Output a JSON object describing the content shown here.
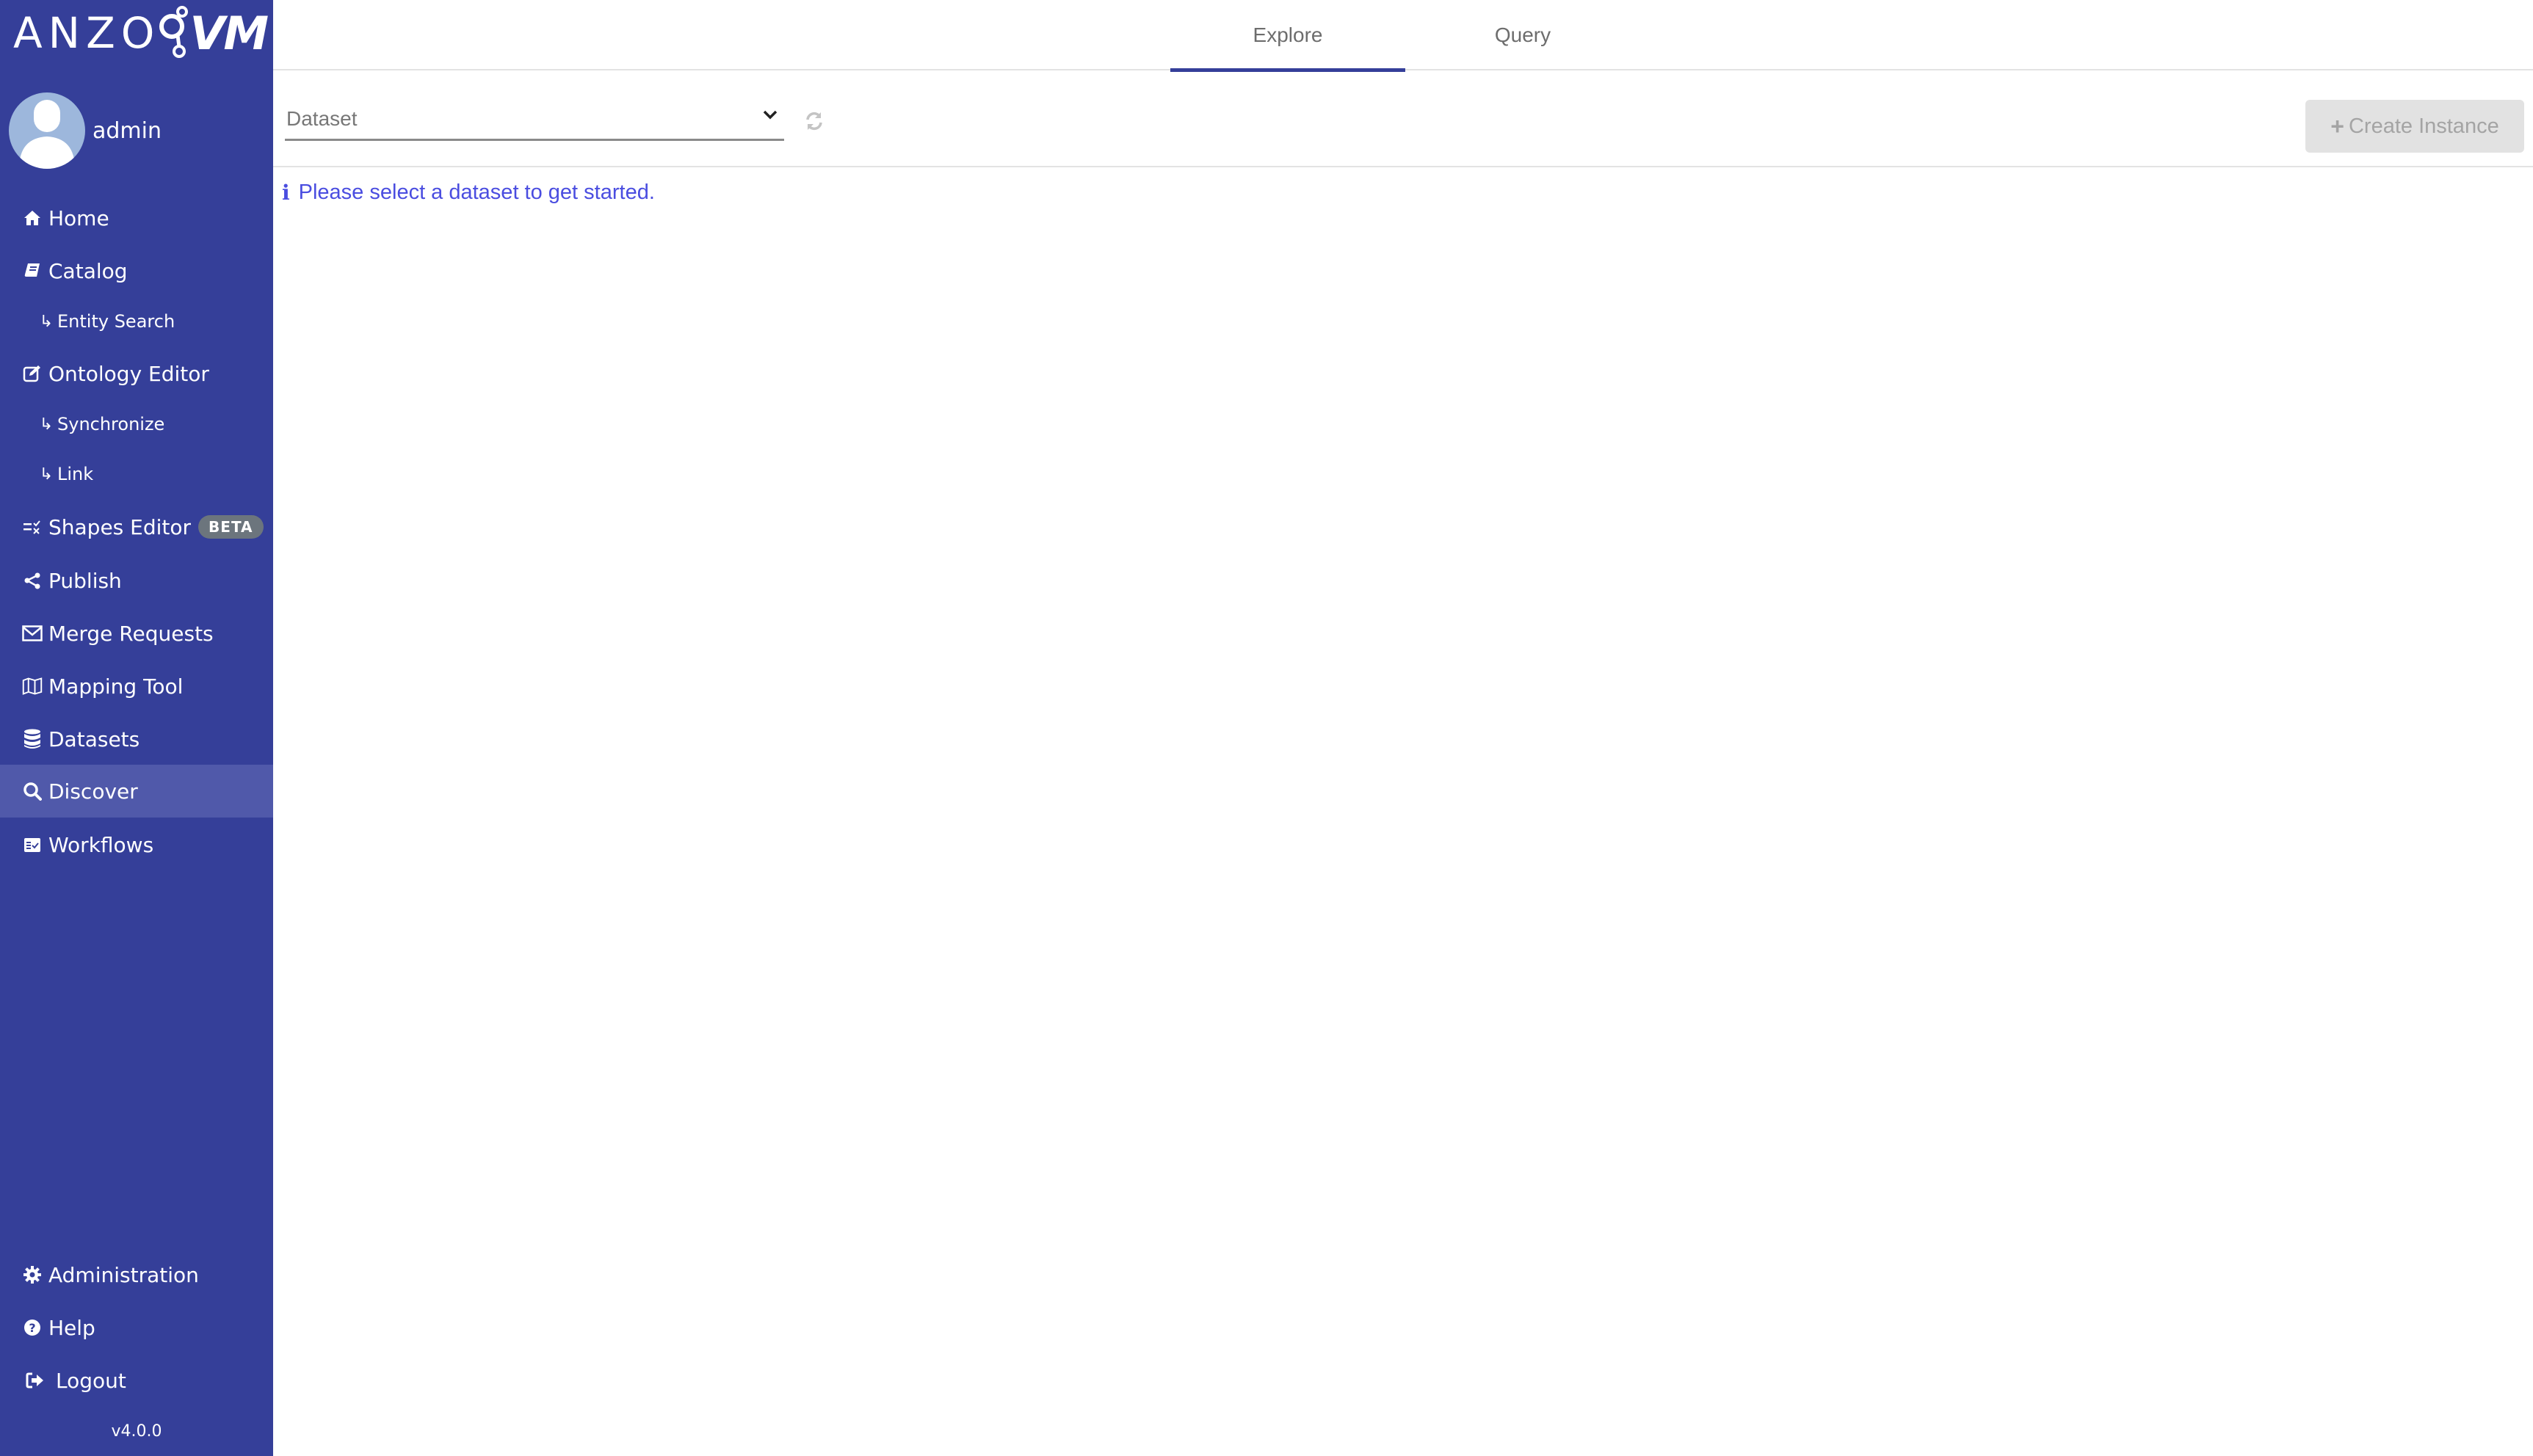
{
  "app": {
    "logo_text": "ANZO",
    "logo_suffix": "VM",
    "version": "v4.0.0"
  },
  "user": {
    "name": "admin"
  },
  "colors": {
    "sidebar_bg": "#353f99",
    "sidebar_active": "#5059aa",
    "info_text": "#4a4de0",
    "badge_bg": "#6c757d"
  },
  "sidebar": {
    "items": [
      {
        "label": "Home",
        "icon": "home-icon"
      },
      {
        "label": "Catalog",
        "icon": "book-icon"
      },
      {
        "label": "Entity Search",
        "icon": "sub-arrow-icon"
      },
      {
        "label": "Ontology Editor",
        "icon": "edit-icon"
      },
      {
        "label": "Synchronize",
        "icon": "sub-arrow-icon"
      },
      {
        "label": "Link",
        "icon": "sub-arrow-icon"
      },
      {
        "label": "Shapes Editor",
        "icon": "shapes-icon",
        "badge": "BETA"
      },
      {
        "label": "Publish",
        "icon": "share-icon"
      },
      {
        "label": "Merge Requests",
        "icon": "envelope-icon"
      },
      {
        "label": "Mapping Tool",
        "icon": "map-icon"
      },
      {
        "label": "Datasets",
        "icon": "database-icon"
      },
      {
        "label": "Discover",
        "icon": "search-icon",
        "active": true
      },
      {
        "label": "Workflows",
        "icon": "workflow-icon"
      }
    ],
    "bottom_items": [
      {
        "label": "Administration",
        "icon": "gear-icon"
      },
      {
        "label": "Help",
        "icon": "question-circle-icon"
      },
      {
        "label": "Logout",
        "icon": "sign-out-icon"
      }
    ]
  },
  "header": {
    "tabs": [
      {
        "label": "Explore",
        "active": true
      },
      {
        "label": "Query",
        "active": false
      }
    ]
  },
  "toolbar": {
    "dataset_placeholder": "Dataset",
    "create_instance_label": "Create Instance",
    "create_instance_enabled": false
  },
  "main": {
    "info_message": "Please select a dataset to get started."
  }
}
